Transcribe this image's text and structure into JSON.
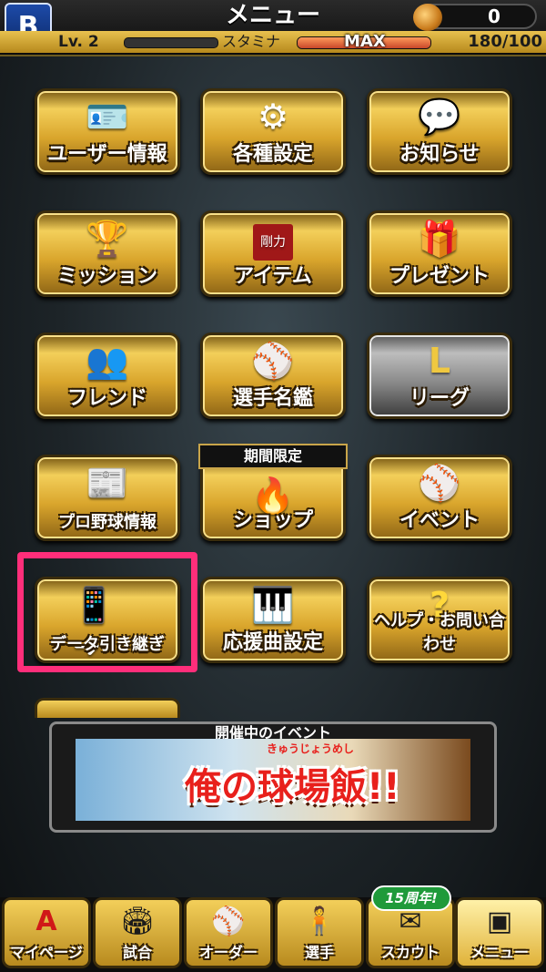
{
  "header": {
    "title": "メニュー",
    "coins": "0",
    "level": "Lv. 2",
    "stamina_label": "スタミナ",
    "stamina_status": "MAX",
    "stamina_value": "180/100",
    "stamina_fill": 1.0
  },
  "menu": {
    "user_info": "ユーザー情報",
    "settings": "各種設定",
    "news": "お知らせ",
    "missions": "ミッション",
    "items": "アイテム",
    "items_book_label": "剛力",
    "presents": "プレゼント",
    "friends": "フレンド",
    "player_dir": "選手名鑑",
    "league": "リーグ",
    "league_letter": "L",
    "pro_news": "プロ野球情報",
    "shop": "ショップ",
    "shop_badge": "期間限定",
    "event": "イベント",
    "data_transfer": "データ引き継ぎ",
    "cheer_songs": "応援曲設定",
    "help": "ヘルプ・お問い合わせ"
  },
  "event_panel": {
    "title": "開催中のイベント",
    "banner_text": "俺の球場飯!!",
    "banner_ruby": "きゅうじょうめし"
  },
  "nav": {
    "mypage": "マイページ",
    "games": "試合",
    "order": "オーダー",
    "players": "選手",
    "scout": "スカウト",
    "menu": "メニュー",
    "anniversary": "15周年!"
  },
  "colors": {
    "gold": "#e1b13a",
    "highlight": "#ff2e7a",
    "stamina": "#d8582e"
  }
}
